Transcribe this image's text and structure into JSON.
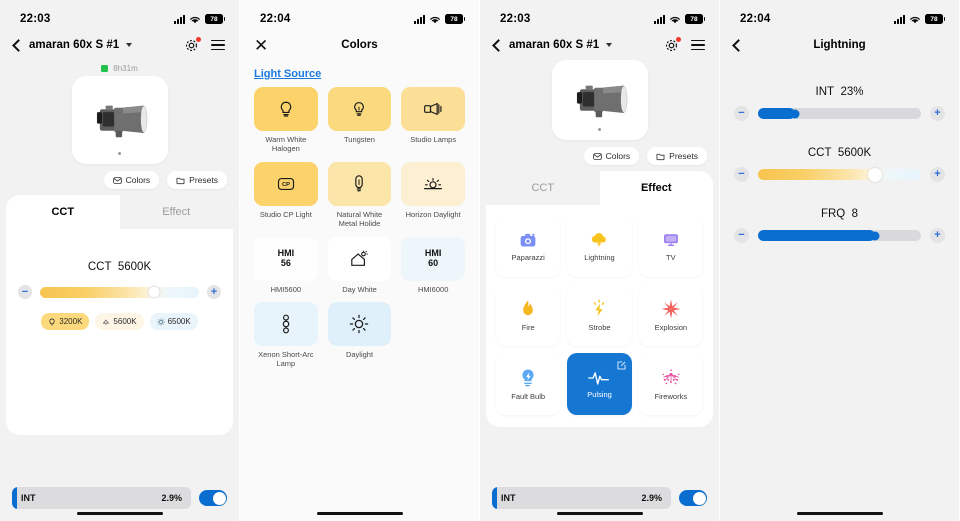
{
  "screen1": {
    "status": {
      "time": "22:03",
      "battery": "78"
    },
    "nav": {
      "title": "amaran 60x S #1",
      "gear_icon": "gear-icon",
      "menu_icon": "hamburger-icon",
      "back_icon": "chevron-left-icon"
    },
    "device": {
      "runtime": "8h31m",
      "status_color": "#23c24a",
      "image_alt": "amaran-60x-s-light"
    },
    "pills": [
      {
        "label": "Colors",
        "icon": "palette-icon"
      },
      {
        "label": "Presets",
        "icon": "folder-icon"
      }
    ],
    "tabs": [
      {
        "label": "CCT",
        "active": true
      },
      {
        "label": "Effect",
        "active": false
      }
    ],
    "cct": {
      "label": "CCT",
      "value": "5600K",
      "slider_percent": 72,
      "minus": "−",
      "plus": "+",
      "presets": [
        {
          "label": "3200K",
          "icon": "bulb-icon",
          "selected": true
        },
        {
          "label": "5600K",
          "icon": "lamp-icon",
          "selected": false
        },
        {
          "label": "6500K",
          "icon": "sun-icon",
          "selected": false
        }
      ]
    },
    "bottom": {
      "label": "INT",
      "value": "2.9%",
      "toggle_on": true
    }
  },
  "screen2": {
    "status": {
      "time": "22:04",
      "battery": "78"
    },
    "nav": {
      "title": "Colors",
      "close_icon": "close-icon"
    },
    "section_title": "Light Source",
    "swatches": [
      {
        "label": "Warm White Halogen",
        "icon": "bulb-icon",
        "bg": "#fbd36a"
      },
      {
        "label": "Tungsten",
        "icon": "bulb-icon",
        "bg": "#fbd97f"
      },
      {
        "label": "Studio Lamps",
        "icon": "studio-lamp-icon",
        "bg": "#fcdf96"
      },
      {
        "label": "Studio CP Light",
        "icon": "cp-icon",
        "bg": "#fbd36a"
      },
      {
        "label": "Natural White Metal Holide",
        "icon": "tube-bulb-icon",
        "bg": "#fce5a9"
      },
      {
        "label": "Horizon Daylight",
        "icon": "sunrise-icon",
        "bg": "#fdefd2"
      },
      {
        "label": "HMI5600",
        "icon": "hmi-56-icon",
        "text": "HMI\n56",
        "bg": "#fefefe"
      },
      {
        "label": "Day White",
        "icon": "house-sun-icon",
        "bg": "#ffffff"
      },
      {
        "label": "HMI6000",
        "icon": "hmi-60-icon",
        "text": "HMI\n60",
        "bg": "#edf6fb"
      },
      {
        "label": "Xenon Short-Arc Lamp",
        "icon": "xenon-icon",
        "bg": "#e8f4fb"
      },
      {
        "label": "Daylight",
        "icon": "sun-icon",
        "bg": "#dff0fa"
      }
    ]
  },
  "screen3": {
    "status": {
      "time": "22:03",
      "battery": "78"
    },
    "nav": {
      "title": "amaran 60x S #1",
      "gear_icon": "gear-icon",
      "menu_icon": "hamburger-icon",
      "back_icon": "chevron-left-icon"
    },
    "device": {
      "image_alt": "amaran-60x-s-light"
    },
    "pills": [
      {
        "label": "Colors",
        "icon": "palette-icon"
      },
      {
        "label": "Presets",
        "icon": "folder-icon"
      }
    ],
    "tabs": [
      {
        "label": "CCT",
        "active": false
      },
      {
        "label": "Effect",
        "active": true
      }
    ],
    "effects": [
      {
        "label": "Paparazzi",
        "icon": "camera-flash-icon",
        "selected": false
      },
      {
        "label": "Lightning",
        "icon": "lightning-cloud-icon",
        "selected": false
      },
      {
        "label": "TV",
        "icon": "tv-icon",
        "selected": false
      },
      {
        "label": "Fire",
        "icon": "flame-icon",
        "selected": false
      },
      {
        "label": "Strobe",
        "icon": "strobe-bolt-icon",
        "selected": false
      },
      {
        "label": "Explosion",
        "icon": "explosion-icon",
        "selected": false
      },
      {
        "label": "Fault Bulb",
        "icon": "fault-bulb-icon",
        "selected": false
      },
      {
        "label": "Pulsing",
        "icon": "pulse-wave-icon",
        "selected": true,
        "edit_icon": "edit-icon"
      },
      {
        "label": "Fireworks",
        "icon": "fireworks-icon",
        "selected": false
      }
    ],
    "bottom": {
      "label": "INT",
      "value": "2.9%",
      "toggle_on": true
    }
  },
  "screen4": {
    "status": {
      "time": "22:04",
      "battery": "78"
    },
    "nav": {
      "title": "Lightning",
      "back_icon": "chevron-left-icon"
    },
    "sliders": [
      {
        "label": "INT",
        "value": "23%",
        "percent": 23,
        "type": "blue",
        "minus": "−",
        "plus": "+"
      },
      {
        "label": "CCT",
        "value": "5600K",
        "percent": 72,
        "type": "cct",
        "minus": "−",
        "plus": "+"
      },
      {
        "label": "FRQ",
        "value": "8",
        "percent": 72,
        "type": "blue",
        "minus": "−",
        "plus": "+"
      }
    ]
  }
}
